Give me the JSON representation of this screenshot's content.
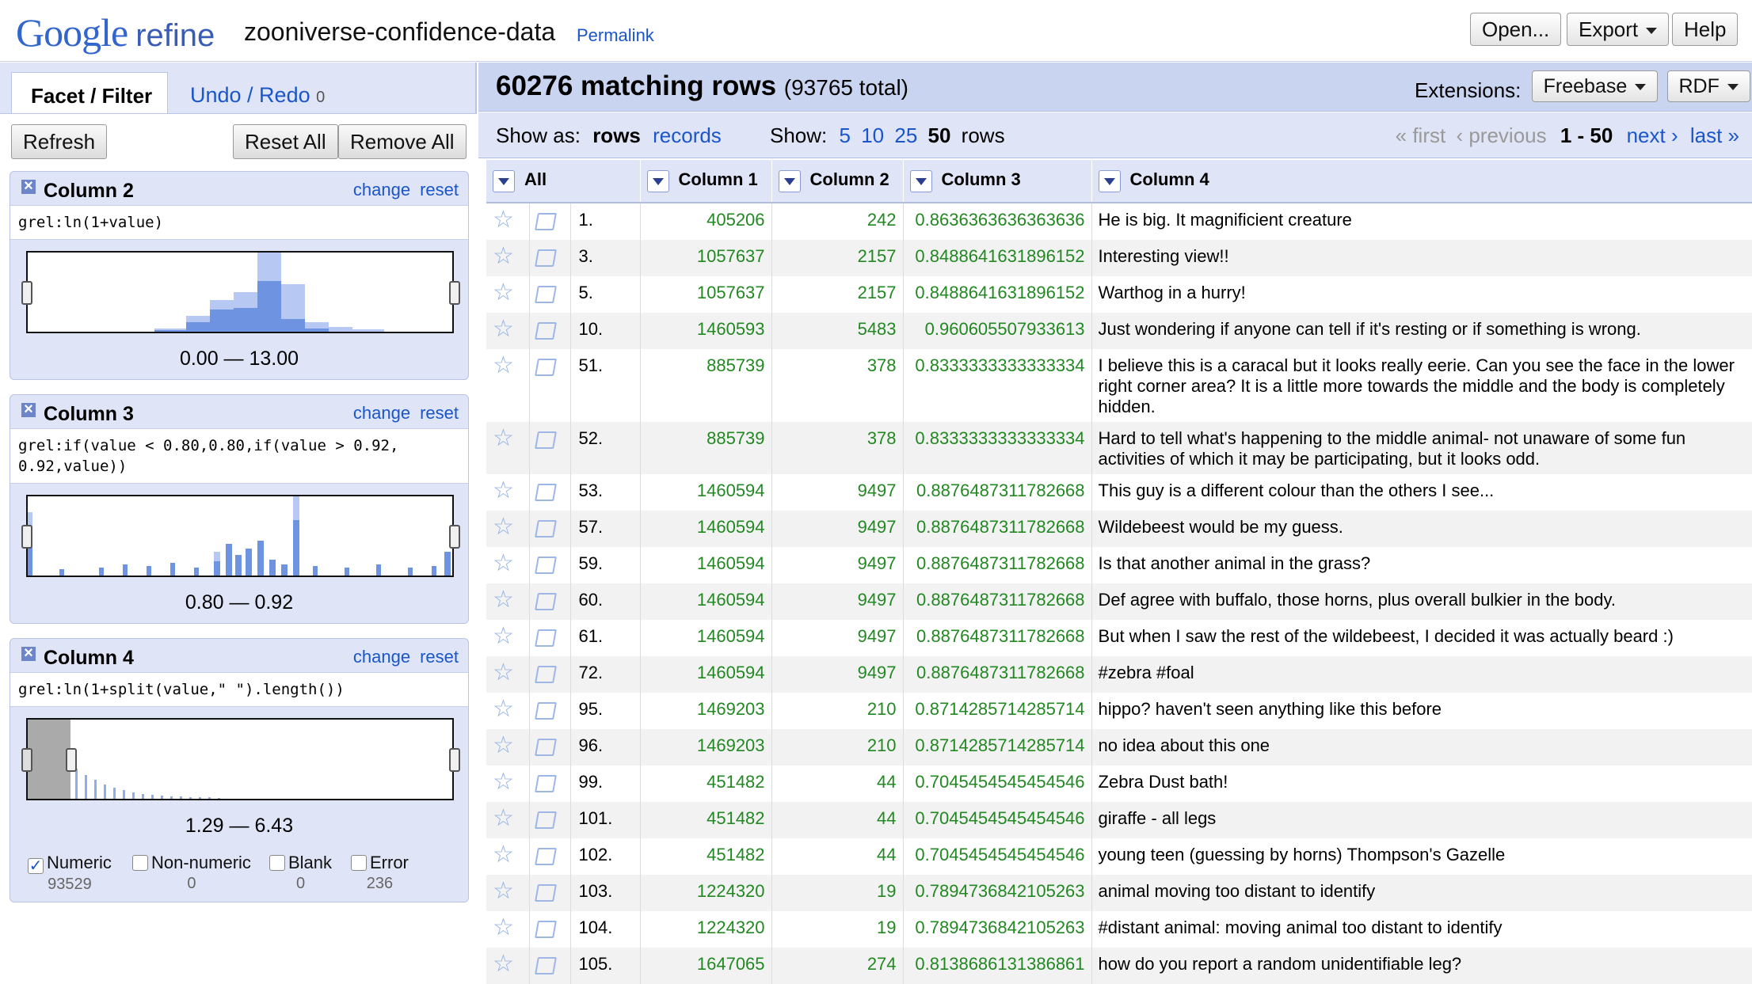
{
  "header": {
    "logo_google": "Google",
    "logo_refine": "refine",
    "project_name": "zooniverse-confidence-data",
    "permalink": "Permalink",
    "open_label": "Open...",
    "export_label": "Export",
    "help_label": "Help"
  },
  "left": {
    "tab_facet": "Facet / Filter",
    "tab_undo": "Undo / Redo",
    "undo_count": "0",
    "refresh": "Refresh",
    "reset_all": "Reset All",
    "remove_all": "Remove All",
    "facets": [
      {
        "title": "Column 2",
        "change": "change",
        "reset": "reset",
        "expr": "grel:ln(1+value)",
        "range": "0.00 — 13.00"
      },
      {
        "title": "Column 3",
        "change": "change",
        "reset": "reset",
        "expr": "grel:if(value < 0.80,0.80,if(value > 0.92, 0.92,value))",
        "range": "0.80 — 0.92"
      },
      {
        "title": "Column 4",
        "change": "change",
        "reset": "reset",
        "expr": "grel:ln(1+split(value,\" \").length())",
        "range": "1.29 — 6.43",
        "checks": [
          {
            "label": "Numeric",
            "count": "93529",
            "checked": true
          },
          {
            "label": "Non-numeric",
            "count": "0",
            "checked": false
          },
          {
            "label": "Blank",
            "count": "0",
            "checked": false
          },
          {
            "label": "Error",
            "count": "236",
            "checked": false
          }
        ]
      }
    ]
  },
  "summary": {
    "matching": "60276 matching rows",
    "total": "(93765 total)",
    "extensions": "Extensions:",
    "freebase": "Freebase",
    "rdf": "RDF"
  },
  "viewbar": {
    "show_as": "Show as:",
    "rows": "rows",
    "records": "records",
    "show": "Show:",
    "n5": "5",
    "n10": "10",
    "n25": "25",
    "n50": "50",
    "rows_word": "rows",
    "first": "« first",
    "previous": "‹ previous",
    "range": "1 - 50",
    "next": "next ›",
    "last": "last »"
  },
  "columns": [
    "All",
    "Column 1",
    "Column 2",
    "Column 3",
    "Column 4"
  ],
  "rows": [
    {
      "idx": "1.",
      "c1": "405206",
      "c2": "242",
      "c3": "0.8636363636363636",
      "c4": "He is big. It magnificient creature"
    },
    {
      "idx": "3.",
      "c1": "1057637",
      "c2": "2157",
      "c3": "0.8488641631896152",
      "c4": "Interesting view!!"
    },
    {
      "idx": "5.",
      "c1": "1057637",
      "c2": "2157",
      "c3": "0.8488641631896152",
      "c4": "Warthog in a hurry!"
    },
    {
      "idx": "10.",
      "c1": "1460593",
      "c2": "5483",
      "c3": "0.960605507933613",
      "c4": "Just wondering if anyone can tell if it's resting or if something is wrong."
    },
    {
      "idx": "51.",
      "c1": "885739",
      "c2": "378",
      "c3": "0.8333333333333334",
      "c4": "I believe this is a caracal but it looks really eerie. Can you see the face in the lower right corner area? It is a little more towards the middle and the body is completely hidden."
    },
    {
      "idx": "52.",
      "c1": "885739",
      "c2": "378",
      "c3": "0.8333333333333334",
      "c4": "Hard to tell what's happening to the middle animal- not unaware of some fun activities of which it may be participating, but it looks odd."
    },
    {
      "idx": "53.",
      "c1": "1460594",
      "c2": "9497",
      "c3": "0.8876487311782668",
      "c4": "This guy is a different colour than the others I see..."
    },
    {
      "idx": "57.",
      "c1": "1460594",
      "c2": "9497",
      "c3": "0.8876487311782668",
      "c4": "Wildebeest would be my guess."
    },
    {
      "idx": "59.",
      "c1": "1460594",
      "c2": "9497",
      "c3": "0.8876487311782668",
      "c4": "Is that another animal in the grass?"
    },
    {
      "idx": "60.",
      "c1": "1460594",
      "c2": "9497",
      "c3": "0.8876487311782668",
      "c4": "Def agree with buffalo, those horns, plus overall bulkier in the body."
    },
    {
      "idx": "61.",
      "c1": "1460594",
      "c2": "9497",
      "c3": "0.8876487311782668",
      "c4": "But when I saw the rest of the wildebeest, I decided it was actually beard :)"
    },
    {
      "idx": "72.",
      "c1": "1460594",
      "c2": "9497",
      "c3": "0.8876487311782668",
      "c4": "#zebra #foal"
    },
    {
      "idx": "95.",
      "c1": "1469203",
      "c2": "210",
      "c3": "0.8714285714285714",
      "c4": "hippo? haven't seen anything like this before"
    },
    {
      "idx": "96.",
      "c1": "1469203",
      "c2": "210",
      "c3": "0.8714285714285714",
      "c4": "no idea about this one"
    },
    {
      "idx": "99.",
      "c1": "451482",
      "c2": "44",
      "c3": "0.7045454545454546",
      "c4": "Zebra Dust bath!"
    },
    {
      "idx": "101.",
      "c1": "451482",
      "c2": "44",
      "c3": "0.7045454545454546",
      "c4": "giraffe - all legs"
    },
    {
      "idx": "102.",
      "c1": "451482",
      "c2": "44",
      "c3": "0.7045454545454546",
      "c4": "young teen (guessing by horns) Thompson's Gazelle"
    },
    {
      "idx": "103.",
      "c1": "1224320",
      "c2": "19",
      "c3": "0.7894736842105263",
      "c4": "animal moving too distant to identify"
    },
    {
      "idx": "104.",
      "c1": "1224320",
      "c2": "19",
      "c3": "0.7894736842105263",
      "c4": "#distant animal: moving animal too distant to identify"
    },
    {
      "idx": "105.",
      "c1": "1647065",
      "c2": "274",
      "c3": "0.8138686131386861",
      "c4": "how do you report a random unidentifiable leg?"
    }
  ],
  "colors": {
    "link": "#1a55c9",
    "numeric": "#228822",
    "panel": "#dfe5f7",
    "header_band": "#c9d4f0"
  }
}
